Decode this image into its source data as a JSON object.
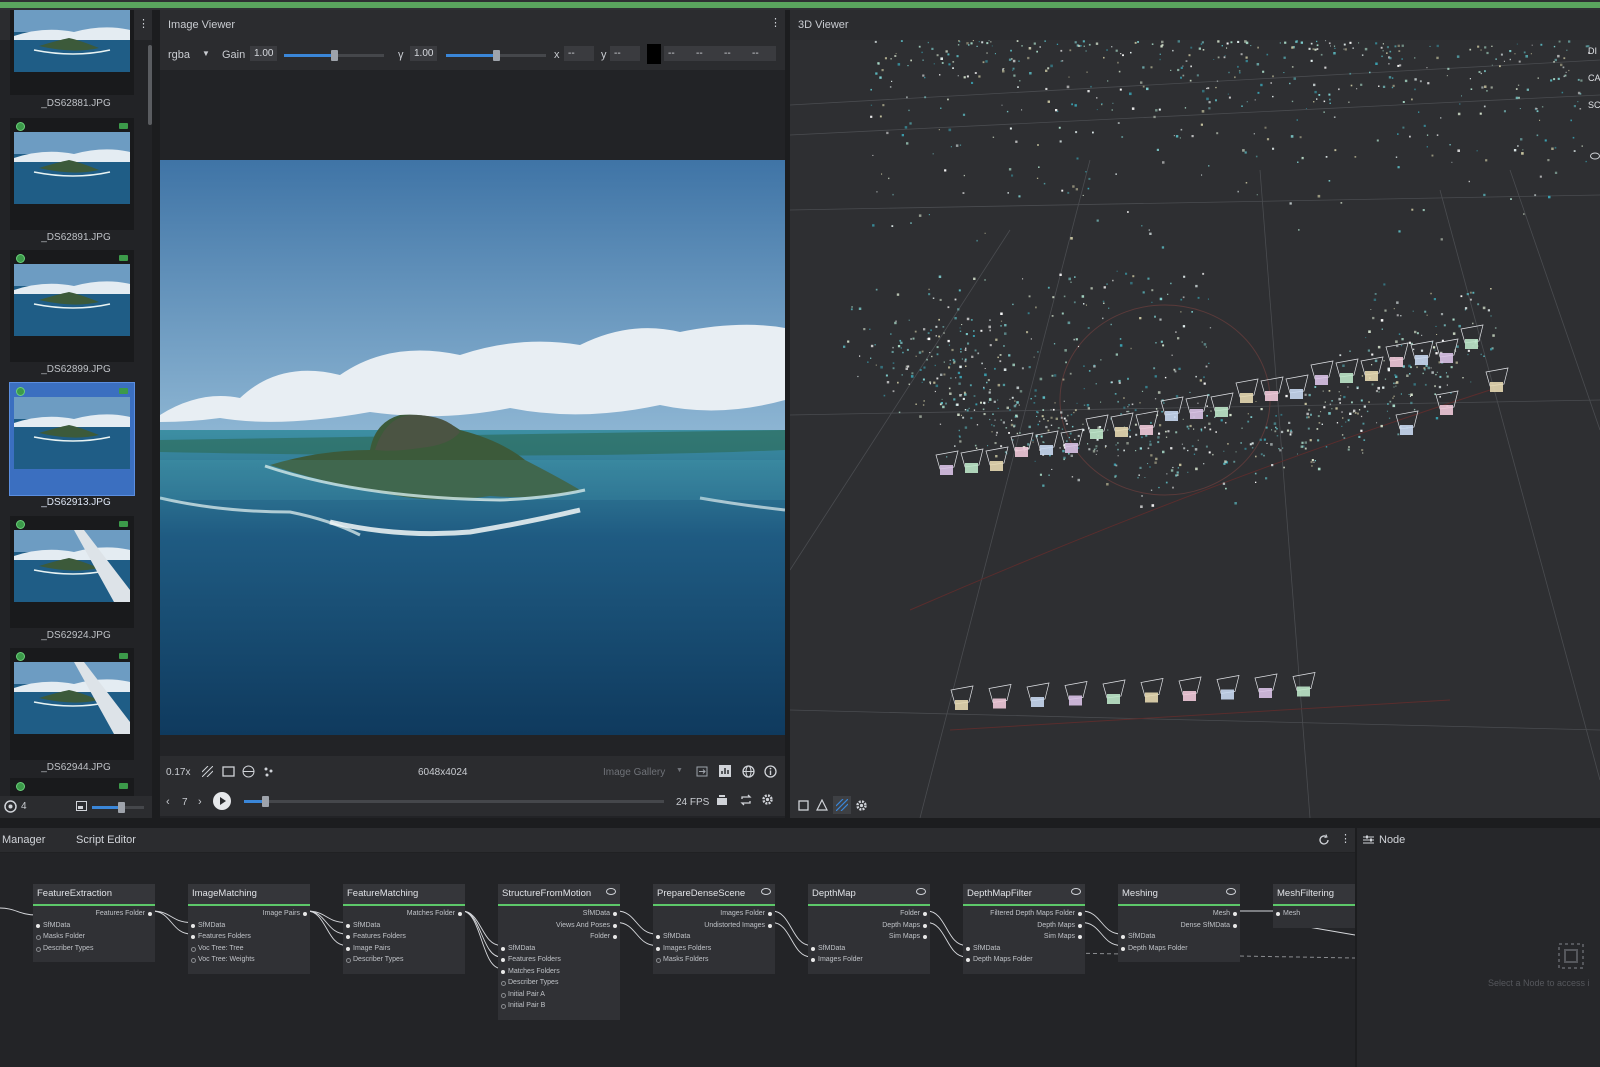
{
  "gallery": {
    "items": [
      {
        "label": "_DS62881.JPG"
      },
      {
        "label": "_DS62891.JPG"
      },
      {
        "label": "_DS62899.JPG"
      },
      {
        "label": "_DS62913.JPG",
        "selected": true
      },
      {
        "label": "_DS62924.JPG"
      },
      {
        "label": "_DS62944.JPG"
      }
    ],
    "count": "4"
  },
  "image_viewer": {
    "title": "Image Viewer",
    "channel": "rgba",
    "gain_label": "Gain",
    "gain_value": "1.00",
    "gamma_label": "γ",
    "gamma_value": "1.00",
    "x_label": "x",
    "x_value": "--",
    "y_label": "y",
    "y_value": "--",
    "pixel_values": [
      "--",
      "--",
      "--",
      "--"
    ],
    "zoom": "0.17x",
    "resolution": "6048x4024",
    "source": "Image Gallery",
    "frame": "7",
    "fps": "24 FPS",
    "gain_level": 0.5,
    "gamma_level": 0.5,
    "timeline_level": 0.05
  },
  "viewer3d": {
    "title": "3D Viewer",
    "side_labels": [
      "DI",
      "CA",
      "SC"
    ]
  },
  "graph": {
    "tabs": [
      "Manager",
      "Script Editor"
    ],
    "nodes": [
      {
        "title": "FeatureExtraction",
        "outputs": [
          "Features Folder"
        ],
        "inputs": [
          "SfMData",
          "Masks Folder",
          "Describer Types"
        ]
      },
      {
        "title": "ImageMatching",
        "outputs": [
          "Image Pairs"
        ],
        "inputs": [
          "SfMData",
          "Features Folders",
          "Voc Tree: Tree",
          "Voc Tree: Weights"
        ]
      },
      {
        "title": "FeatureMatching",
        "outputs": [
          "Matches Folder"
        ],
        "inputs": [
          "SfMData",
          "Features Folders",
          "Image Pairs",
          "Describer Types"
        ]
      },
      {
        "title": "StructureFromMotion",
        "outputs": [
          "SfMData",
          "Views And Poses",
          "Folder"
        ],
        "inputs": [
          "SfMData",
          "Features Folders",
          "Matches Folders",
          "Describer Types",
          "Initial Pair A",
          "Initial Pair B"
        ]
      },
      {
        "title": "PrepareDenseScene",
        "outputs": [
          "Images Folder",
          "Undistorted Images"
        ],
        "inputs": [
          "SfMData",
          "Images Folders",
          "Masks Folders"
        ]
      },
      {
        "title": "DepthMap",
        "outputs": [
          "Folder",
          "Depth Maps",
          "Sim Maps"
        ],
        "inputs": [
          "SfMData",
          "Images Folder"
        ]
      },
      {
        "title": "DepthMapFilter",
        "outputs": [
          "Filtered Depth Maps Folder",
          "Depth Maps",
          "Sim Maps"
        ],
        "inputs": [
          "SfMData",
          "Depth Maps Folder"
        ]
      },
      {
        "title": "Meshing",
        "outputs": [
          "Mesh",
          "Dense SfMData"
        ],
        "inputs": [
          "SfMData",
          "Depth Maps Folder"
        ]
      },
      {
        "title": "MeshFiltering",
        "outputs": [],
        "inputs": [
          "Mesh"
        ]
      }
    ]
  },
  "node_panel": {
    "title": "Node",
    "hint": "Select a Node to access i"
  }
}
